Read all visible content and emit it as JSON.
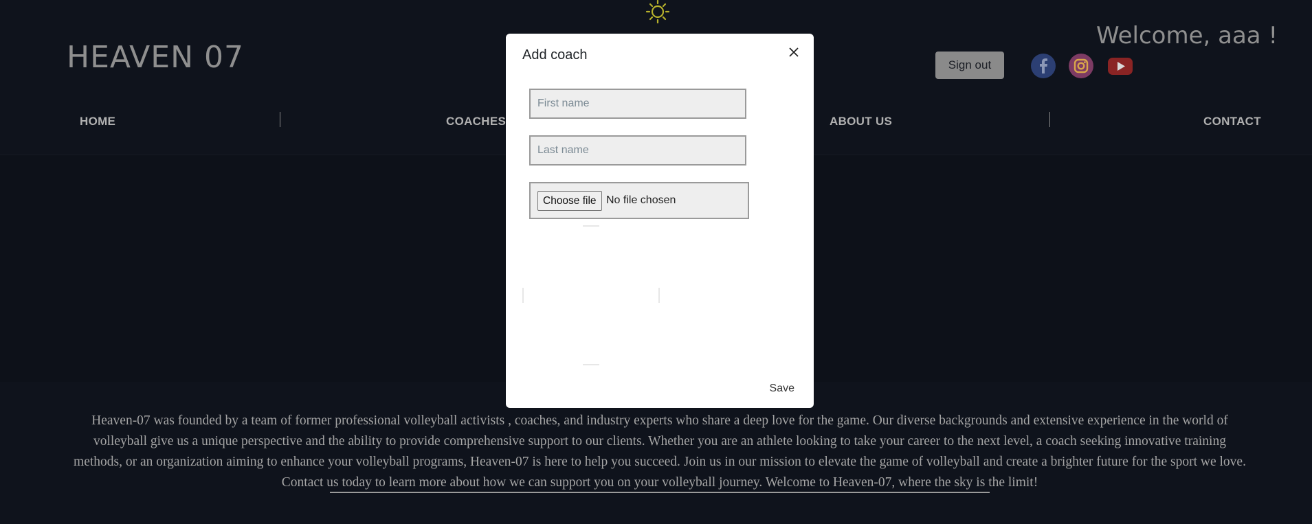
{
  "header": {
    "logo": "HEAVEN 07",
    "welcome": "Welcome, aaa !",
    "sign_out": "Sign out",
    "social": [
      "facebook-icon",
      "instagram-icon",
      "youtube-icon"
    ]
  },
  "nav": {
    "items": [
      {
        "label": "HOME"
      },
      {
        "label": "COACHES"
      },
      {
        "label": "ABOUT US"
      },
      {
        "label": "CONTACT"
      }
    ]
  },
  "about": {
    "text": "Heaven-07 was founded by a team of former professional volleyball activists , coaches, and industry experts who share a deep love for the game. Our diverse backgrounds and extensive experience in the world of volleyball give us a unique perspective and the ability to provide comprehensive support to our clients. Whether you are an athlete looking to take your career to the next level, a coach seeking innovative training methods, or an organization aiming to enhance your volleyball programs, Heaven-07 is here to help you succeed. Join us in our mission to elevate the game of volleyball and create a brighter future for the sport we love. Contact us today to learn more about how we can support you on your volleyball journey. Welcome to Heaven-07, where the sky is the limit!"
  },
  "modal": {
    "title": "Add coach",
    "first_name_placeholder": "First name",
    "last_name_placeholder": "Last name",
    "choose_file": "Choose file",
    "no_file": "No file chosen",
    "save": "Save"
  },
  "colors": {
    "page_bg": "#0f131c",
    "nav_text": "#b1b1b1",
    "modal_bg": "#ffffff",
    "sun": "#c9c32a",
    "facebook": "#3b5998",
    "youtube": "#c4302b"
  }
}
